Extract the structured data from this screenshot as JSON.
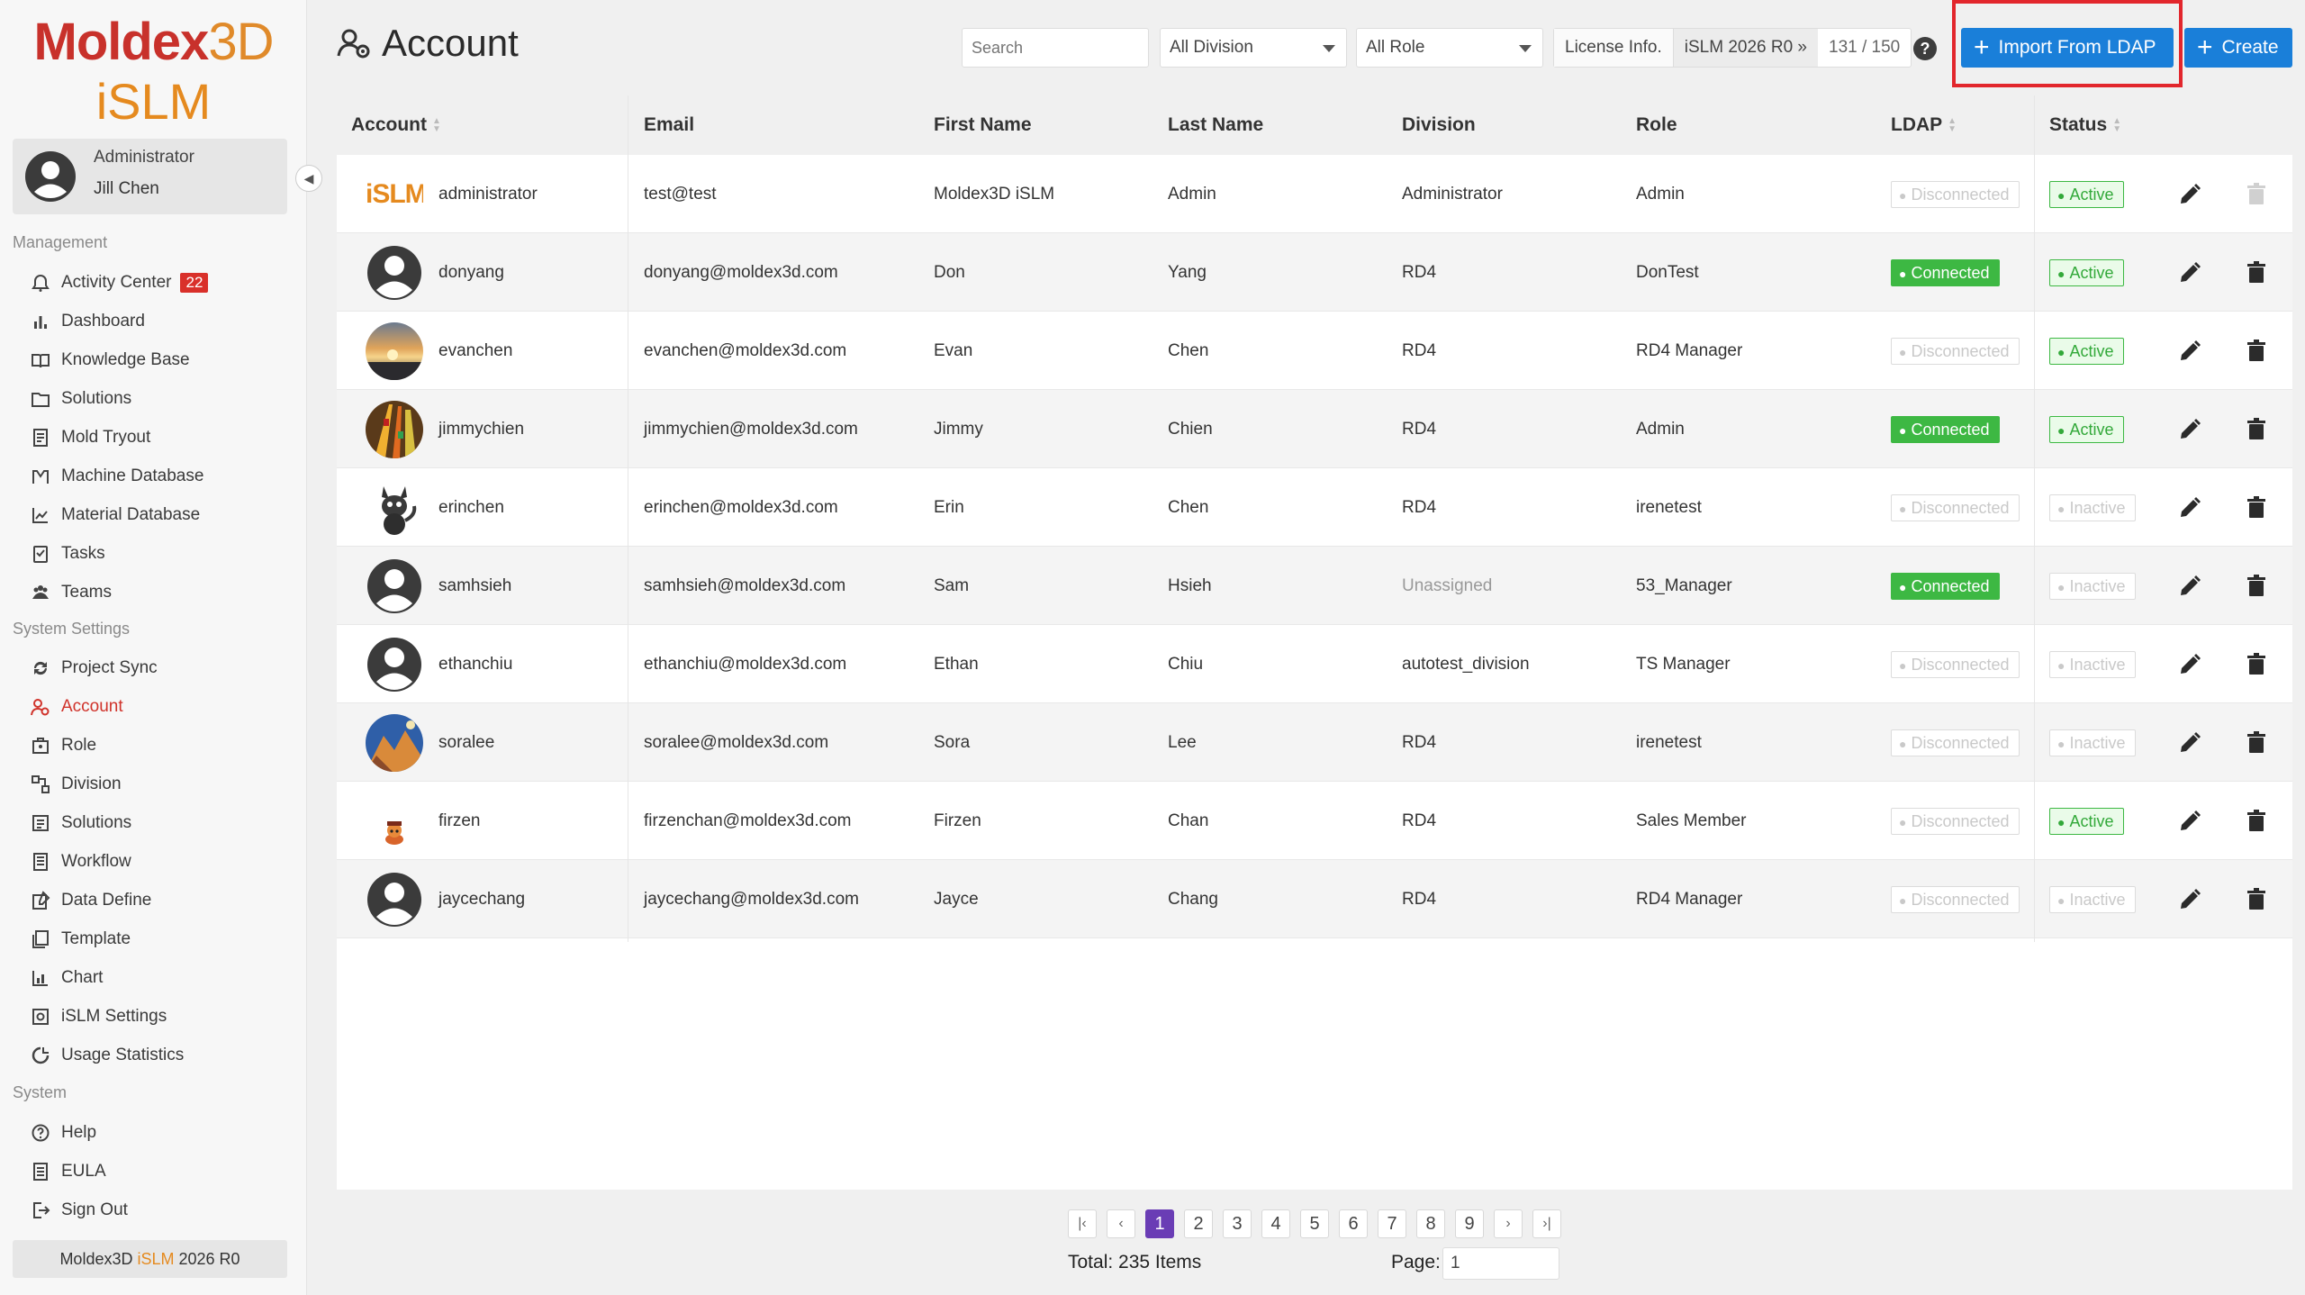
{
  "brand": {
    "name_part1": "Moldex",
    "name_part2": "3D",
    "product": "iSLM"
  },
  "user": {
    "role": "Administrator",
    "name": "Jill Chen"
  },
  "sidebar": {
    "management_label": "Management",
    "management": [
      {
        "label": "Activity Center",
        "icon": "bell-icon",
        "badge": "22"
      },
      {
        "label": "Dashboard",
        "icon": "bar-chart-icon"
      },
      {
        "label": "Knowledge Base",
        "icon": "book-icon"
      },
      {
        "label": "Solutions",
        "icon": "folder-icon"
      },
      {
        "label": "Mold Tryout",
        "icon": "document-icon"
      },
      {
        "label": "Machine Database",
        "icon": "machine-icon"
      },
      {
        "label": "Material Database",
        "icon": "line-chart-icon"
      },
      {
        "label": "Tasks",
        "icon": "task-icon"
      },
      {
        "label": "Teams",
        "icon": "team-icon"
      }
    ],
    "system_settings_label": "System Settings",
    "system_settings": [
      {
        "label": "Project Sync",
        "icon": "sync-icon"
      },
      {
        "label": "Account",
        "icon": "account-icon",
        "active": true
      },
      {
        "label": "Role",
        "icon": "role-icon"
      },
      {
        "label": "Division",
        "icon": "division-icon"
      },
      {
        "label": "Solutions",
        "icon": "solutions-icon"
      },
      {
        "label": "Workflow",
        "icon": "workflow-icon"
      },
      {
        "label": "Data Define",
        "icon": "data-define-icon"
      },
      {
        "label": "Template",
        "icon": "template-icon"
      },
      {
        "label": "Chart",
        "icon": "chart-icon"
      },
      {
        "label": "iSLM Settings",
        "icon": "settings-icon"
      },
      {
        "label": "Usage Statistics",
        "icon": "statistics-icon"
      }
    ],
    "system_label": "System",
    "system": [
      {
        "label": "Help",
        "icon": "help-icon"
      },
      {
        "label": "EULA",
        "icon": "eula-icon"
      },
      {
        "label": "Sign Out",
        "icon": "sign-out-icon"
      }
    ],
    "version": {
      "prefix": "Moldex3D ",
      "product": "iSLM",
      "suffix": " 2026 R0"
    }
  },
  "header": {
    "title": "Account",
    "search_placeholder": "Search",
    "division_filter": "All Division",
    "role_filter": "All Role",
    "license_label": "License Info.",
    "license_version": "iSLM 2026 R0 »",
    "license_count": "131 / 150",
    "import_button": "Import From LDAP",
    "create_button": "Create"
  },
  "table": {
    "columns": [
      "Account",
      "Email",
      "First Name",
      "Last Name",
      "Division",
      "Role",
      "LDAP",
      "Status"
    ],
    "rows": [
      {
        "account": "administrator",
        "email": "test@test",
        "first": "Moldex3D iSLM",
        "last": "Admin",
        "division": "Administrator",
        "role": "Admin",
        "ldap": "Disconnected",
        "status": "Active",
        "avatar": "islm",
        "deletable": false
      },
      {
        "account": "donyang",
        "email": "donyang@moldex3d.com",
        "first": "Don",
        "last": "Yang",
        "division": "RD4",
        "role": "DonTest",
        "ldap": "Connected",
        "status": "Active",
        "avatar": "default",
        "deletable": true
      },
      {
        "account": "evanchen",
        "email": "evanchen@moldex3d.com",
        "first": "Evan",
        "last": "Chen",
        "division": "RD4",
        "role": "RD4 Manager",
        "ldap": "Disconnected",
        "status": "Active",
        "avatar": "sunset",
        "deletable": true
      },
      {
        "account": "jimmychien",
        "email": "jimmychien@moldex3d.com",
        "first": "Jimmy",
        "last": "Chien",
        "division": "RD4",
        "role": "Admin",
        "ldap": "Connected",
        "status": "Active",
        "avatar": "lights",
        "deletable": true
      },
      {
        "account": "erinchen",
        "email": "erinchen@moldex3d.com",
        "first": "Erin",
        "last": "Chen",
        "division": "RD4",
        "role": "irenetest",
        "ldap": "Disconnected",
        "status": "Inactive",
        "avatar": "creature",
        "deletable": true
      },
      {
        "account": "samhsieh",
        "email": "samhsieh@moldex3d.com",
        "first": "Sam",
        "last": "Hsieh",
        "division": "Unassigned",
        "role": "53_Manager",
        "ldap": "Connected",
        "status": "Inactive",
        "avatar": "default",
        "deletable": true
      },
      {
        "account": "ethanchiu",
        "email": "ethanchiu@moldex3d.com",
        "first": "Ethan",
        "last": "Chiu",
        "division": "autotest_division",
        "role": "TS Manager",
        "ldap": "Disconnected",
        "status": "Inactive",
        "avatar": "default",
        "deletable": true
      },
      {
        "account": "soralee",
        "email": "soralee@moldex3d.com",
        "first": "Sora",
        "last": "Lee",
        "division": "RD4",
        "role": "irenetest",
        "ldap": "Disconnected",
        "status": "Inactive",
        "avatar": "mountain",
        "deletable": true
      },
      {
        "account": "firzen",
        "email": "firzenchan@moldex3d.com",
        "first": "Firzen",
        "last": "Chan",
        "division": "RD4",
        "role": "Sales Member",
        "ldap": "Disconnected",
        "status": "Active",
        "avatar": "character",
        "deletable": true
      },
      {
        "account": "jaycechang",
        "email": "jaycechang@moldex3d.com",
        "first": "Jayce",
        "last": "Chang",
        "division": "RD4",
        "role": "RD4 Manager",
        "ldap": "Disconnected",
        "status": "Inactive",
        "avatar": "default",
        "deletable": true
      }
    ]
  },
  "pagination": {
    "first": "|‹",
    "prev": "‹",
    "next": "›",
    "last": "›|",
    "pages": [
      "1",
      "2",
      "3",
      "4",
      "5",
      "6",
      "7",
      "8",
      "9"
    ],
    "current": "1",
    "total_label": "Total: 235 Items",
    "page_label": "Page:",
    "page_value": "1"
  },
  "colors": {
    "accent": "#1a7fd9",
    "brand_red": "#c8312b",
    "brand_orange": "#e58a1f",
    "connected": "#3db843",
    "active_nav": "#d0332b",
    "highlight": "#e2262c",
    "pager_current": "#6a3db5"
  }
}
